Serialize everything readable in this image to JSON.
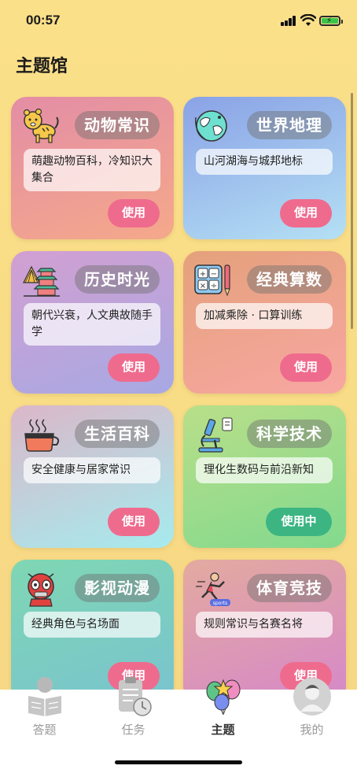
{
  "status_bar": {
    "time": "00:57"
  },
  "header": {
    "title": "主题馆"
  },
  "cards": [
    {
      "title": "动物常识",
      "desc": "萌趣动物百科，冷知识大集合",
      "button": "使用",
      "icon": "tiger-icon",
      "gradient": [
        "#e58ea3",
        "#f4a58a"
      ]
    },
    {
      "title": "世界地理",
      "desc": "山河湖海与城邦地标",
      "button": "使用",
      "icon": "globe-icon",
      "gradient": [
        "#8fa8e6",
        "#b2ddf3"
      ]
    },
    {
      "title": "历史时光",
      "desc": "朝代兴衰，人文典故随手学",
      "button": "使用",
      "icon": "temple-icon",
      "gradient": [
        "#cc9bd3",
        "#a9a6e2"
      ]
    },
    {
      "title": "经典算数",
      "desc": "加减乘除 · 口算训练",
      "button": "使用",
      "icon": "calculator-icon",
      "gradient": [
        "#e6a07e",
        "#f7a5a0"
      ]
    },
    {
      "title": "生活百科",
      "desc": "安全健康与居家常识",
      "button": "使用",
      "icon": "teacup-icon",
      "gradient": [
        "#d9b8c8",
        "#a6e9ec"
      ]
    },
    {
      "title": "科学技术",
      "desc": "理化生数码与前沿新知",
      "button": "使用中",
      "icon": "microscope-icon",
      "gradient": [
        "#b5df8a",
        "#83d98c"
      ],
      "active": true
    },
    {
      "title": "影视动漫",
      "desc": "经典角色与名场面",
      "button": "使用",
      "icon": "superhero-icon",
      "gradient": [
        "#7fd8b8",
        "#74c6c6"
      ]
    },
    {
      "title": "体育竞技",
      "desc": "规则常识与名赛名将",
      "button": "使用",
      "icon": "runner-icon",
      "gradient": [
        "#e2a9a0",
        "#d889c8"
      ]
    }
  ],
  "tabbar": {
    "tabs": [
      {
        "label": "答题",
        "icon": "reading-icon"
      },
      {
        "label": "任务",
        "icon": "clipboard-clock-icon"
      },
      {
        "label": "主题",
        "icon": "balloons-icon",
        "selected": true
      },
      {
        "label": "我的",
        "icon": "avatar-icon"
      }
    ]
  },
  "colors": {
    "use_button": "#ef6b8e",
    "active_button": "#3cb583",
    "background": "#fbe08a"
  }
}
